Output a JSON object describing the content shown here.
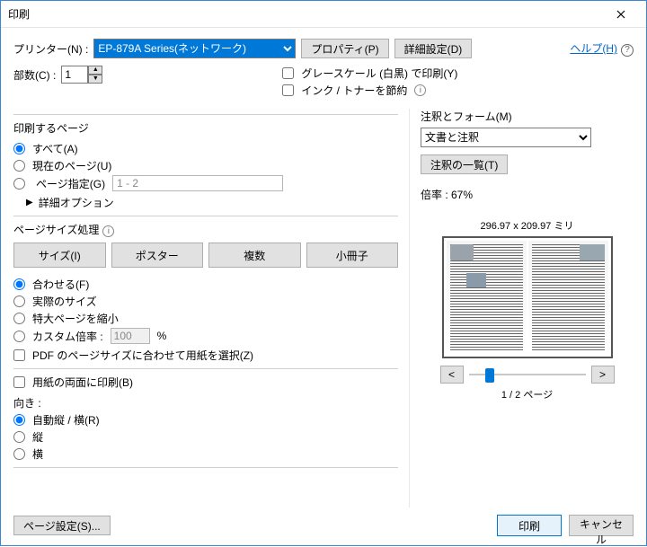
{
  "window": {
    "title": "印刷"
  },
  "top": {
    "printer_label": "プリンター(N) :",
    "printer_selected": "EP-879A Series(ネットワーク)",
    "properties_btn": "プロパティ(P)",
    "advanced_btn": "詳細設定(D)",
    "help_link": "ヘルプ(H)"
  },
  "copies": {
    "label": "部数(C) :",
    "value": "1"
  },
  "checks": {
    "grayscale": "グレースケール (白黒) で印刷(Y)",
    "ink_save": "インク / トナーを節約"
  },
  "pages": {
    "title": "印刷するページ",
    "all": "すべて(A)",
    "current": "現在のページ(U)",
    "range_label": "ページ指定(G)",
    "range_value": "1 - 2",
    "more": "詳細オプション"
  },
  "sizing": {
    "title": "ページサイズ処理",
    "tabs": {
      "size": "サイズ(I)",
      "poster": "ポスター",
      "multi": "複数",
      "booklet": "小冊子"
    },
    "fit": "合わせる(F)",
    "actual": "実際のサイズ",
    "shrink": "特大ページを縮小",
    "custom": "カスタム倍率 :",
    "custom_value": "100",
    "custom_pct": "%",
    "paper_source": "PDF のページサイズに合わせて用紙を選択(Z)",
    "duplex": "用紙の両面に印刷(B)"
  },
  "orient": {
    "label": "向き :",
    "auto": "自動縦 / 横(R)",
    "portrait": "縦",
    "landscape": "横"
  },
  "right": {
    "anno_label": "注釈とフォーム(M)",
    "anno_selected": "文書と注釈",
    "anno_list_btn": "注釈の一覧(T)",
    "scale_label": "倍率 : 67%",
    "preview_dim": "296.97 x 209.97 ミリ",
    "page_indicator": "1 / 2 ページ",
    "prev": "<",
    "next": ">"
  },
  "footer": {
    "page_setup": "ページ設定(S)...",
    "print": "印刷",
    "cancel": "キャンセル"
  }
}
